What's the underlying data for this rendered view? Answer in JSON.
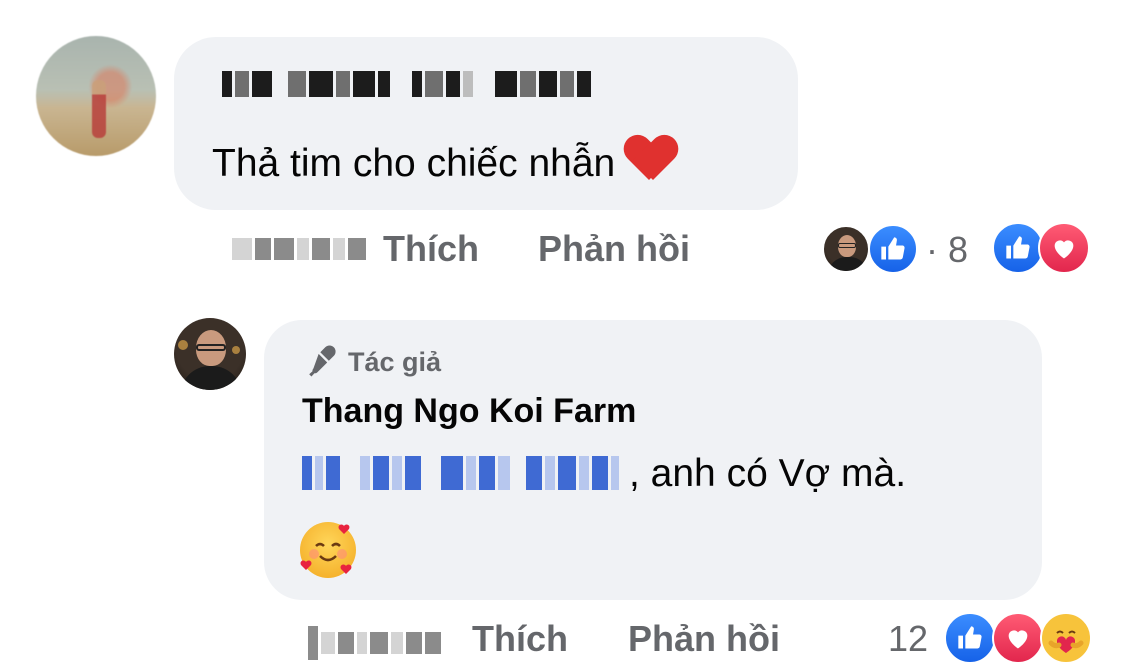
{
  "comment_1": {
    "text": "Thả tim cho chiếc nhẫn",
    "actions": {
      "like": "Thích",
      "reply": "Phản hồi"
    },
    "reactions": {
      "separator": "·",
      "count": "8",
      "icons": [
        "like-icon",
        "love-icon"
      ]
    }
  },
  "comment_2": {
    "badge": "Tác giả",
    "author": "Thang Ngo Koi Farm",
    "text": ", anh có Vợ mà.",
    "emoji": "smiling-face-with-hearts-icon",
    "actions": {
      "like": "Thích",
      "reply": "Phản hồi"
    },
    "reactions": {
      "count": "12",
      "icons": [
        "like-icon",
        "love-icon",
        "care-icon"
      ]
    }
  },
  "colors": {
    "bubble": "#f0f2f5",
    "secondary_text": "#65676b",
    "like_blue": "#1877f2",
    "love_red": "#e2264d",
    "mention_blue": "#3f6ad3"
  }
}
